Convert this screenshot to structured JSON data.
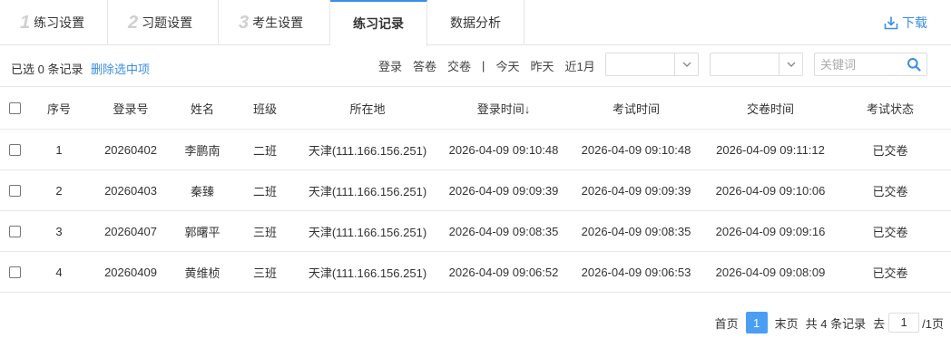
{
  "tabs": [
    {
      "num": "1",
      "label": "练习设置"
    },
    {
      "num": "2",
      "label": "习题设置"
    },
    {
      "num": "3",
      "label": "考生设置"
    },
    {
      "label": "练习记录"
    },
    {
      "label": "数据分析"
    }
  ],
  "download_label": "下载",
  "toolbar": {
    "selected_text": "已选 0 条记录",
    "delete_selected": "删除选中项",
    "filters": [
      "登录",
      "答卷",
      "交卷"
    ],
    "separator": "|",
    "ranges": [
      "今天",
      "昨天",
      "近1月"
    ],
    "select1_value": "",
    "select2_value": "",
    "search_placeholder": "关键词"
  },
  "table": {
    "headers": [
      "序号",
      "登录号",
      "姓名",
      "班级",
      "所在地",
      "登录时间↓",
      "考试时间",
      "交卷时间",
      "考试状态"
    ],
    "rows": [
      [
        "1",
        "20260402",
        "李鹏南",
        "二班",
        "天津(111.166.156.251)",
        "2026-04-09 09:10:48",
        "2026-04-09 09:10:48",
        "2026-04-09 09:11:12",
        "已交卷"
      ],
      [
        "2",
        "20260403",
        "秦臻",
        "二班",
        "天津(111.166.156.251)",
        "2026-04-09 09:09:39",
        "2026-04-09 09:09:39",
        "2026-04-09 09:10:06",
        "已交卷"
      ],
      [
        "3",
        "20260407",
        "郭曙平",
        "三班",
        "天津(111.166.156.251)",
        "2026-04-09 09:08:35",
        "2026-04-09 09:08:35",
        "2026-04-09 09:09:16",
        "已交卷"
      ],
      [
        "4",
        "20260409",
        "黄维桢",
        "三班",
        "天津(111.166.156.251)",
        "2026-04-09 09:06:52",
        "2026-04-09 09:06:53",
        "2026-04-09 09:08:09",
        "已交卷"
      ]
    ]
  },
  "pager": {
    "first": "首页",
    "current": "1",
    "last": "末页",
    "total": "共 4 条记录",
    "goto_label": "去",
    "goto_value": "1",
    "pages": "/1页"
  },
  "colors": {
    "accent": "#3a8ee6",
    "active_page": "#4a9ff5"
  },
  "icons": {
    "download": "download-icon",
    "search": "search-icon",
    "dropdown": "chevron-down-icon"
  }
}
